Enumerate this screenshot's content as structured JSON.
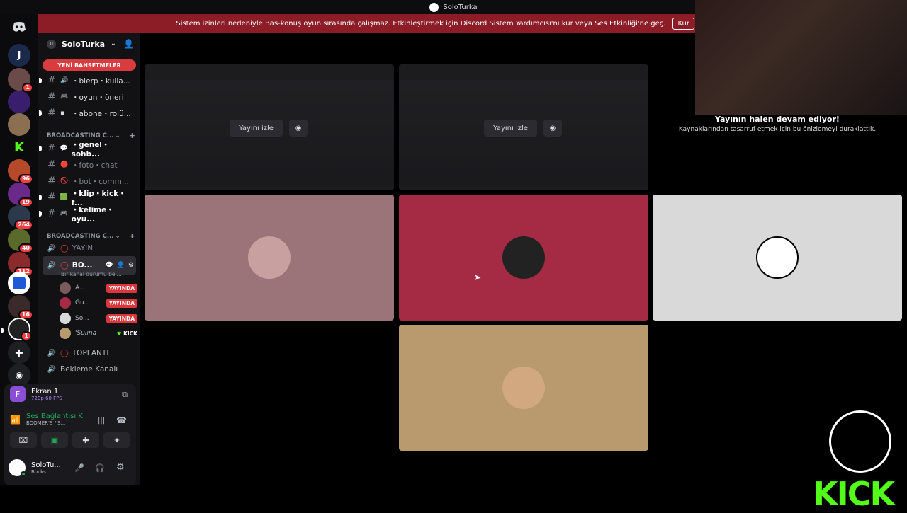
{
  "window": {
    "title": "SoloTurka"
  },
  "banner": {
    "text": "Sistem izinleri nedeniyle Bas-konuş oyun sırasında çalışmaz. Etkinleştirmek için Discord Sistem Yardımcısı'nı kur veya Ses Etkinliği'ne geç.",
    "button": "Kur"
  },
  "guilds": [
    {
      "icon": "discord-home-icon",
      "color": "#0b0b0d",
      "label": ""
    },
    {
      "label": "J",
      "color": "#1b2a4a",
      "badge": ""
    },
    {
      "label": "",
      "color": "#6b4a4a",
      "badge": "1"
    },
    {
      "label": "",
      "color": "#3a1e6e",
      "badge": ""
    },
    {
      "label": "",
      "color": "#8a7050",
      "badge": ""
    },
    {
      "label": "K",
      "color": "#53fc18",
      "badge": ""
    },
    {
      "label": "",
      "color": "#b44a2a",
      "badge": "96"
    },
    {
      "label": "",
      "color": "#6a2a8a",
      "badge": "19"
    },
    {
      "label": "",
      "color": "#2a3a4a",
      "badge": "264"
    },
    {
      "label": "",
      "color": "#5a6a2a",
      "badge": "40"
    },
    {
      "label": "",
      "color": "#8a2a2a",
      "badge": "112"
    },
    {
      "label": "",
      "color": "#1e5ad6",
      "badge": ""
    },
    {
      "label": "",
      "color": "#3a2a2a",
      "badge": "16"
    },
    {
      "label": "",
      "color": "#222",
      "badge": "1"
    }
  ],
  "server": {
    "name": "SoloTurka",
    "boost": "0"
  },
  "mentions_pill": "YENİ BAHSETMELER",
  "channels_top": [
    {
      "emoji": "🔊",
      "name": "・blerp・kulla..."
    },
    {
      "emoji": "🎮",
      "name": "・oyun・öneri"
    },
    {
      "emoji": "▪",
      "name": "・abone・rolü..."
    }
  ],
  "category1": "BROADCASTING C...",
  "channels_mid": [
    {
      "emoji": "💬",
      "name": "・genel・sohb...",
      "muted": false
    },
    {
      "emoji": "🔴",
      "name": "・foto・chat",
      "muted": true
    },
    {
      "emoji": "🚫",
      "name": "・bot・comm...",
      "muted": true
    },
    {
      "emoji": "🟩",
      "name": "・klip・kick・f...",
      "muted": false
    },
    {
      "emoji": "🎮",
      "name": "・kelime・oyu...",
      "muted": false
    }
  ],
  "category2": "BROADCASTING C...",
  "voice": {
    "yayin": "YAYIN",
    "active_name": "BO...",
    "active_status": "Bir kanal durumu bel...",
    "users": [
      {
        "name": "A...",
        "tag": "YAYINDA"
      },
      {
        "name": "Gu...",
        "tag": "YAYINDA"
      },
      {
        "name": "So...",
        "tag": "YAYINDA"
      },
      {
        "name": "'Sulina",
        "tag": "KICK"
      }
    ],
    "toplanti": "TOPLANTI",
    "bekleme": "Bekleme Kanalı"
  },
  "panel": {
    "screen_name": "Ekran 1",
    "screen_quality": "720p 60 FPS",
    "voice_status": "Ses Bağlantısı K",
    "voice_channel": "BOOMER'S / S...",
    "user_name": "SoloTu...",
    "user_status": "Bucks..."
  },
  "streams": [
    {
      "watch_label": "Yayını izle"
    },
    {
      "watch_label": "Yayını izle"
    }
  ],
  "tiles": [
    {
      "color": "#9b7479"
    },
    {
      "color": "#a52a44"
    },
    {
      "color": "#d9d9d9"
    },
    {
      "color": "#b89a6e"
    }
  ],
  "paused": {
    "title": "Yayının halen devam ediyor!",
    "subtitle": "Kaynaklarından tasarruf etmek için bu önizlemeyi duraklattık."
  },
  "overlay": {
    "kick_text": "KICK"
  }
}
